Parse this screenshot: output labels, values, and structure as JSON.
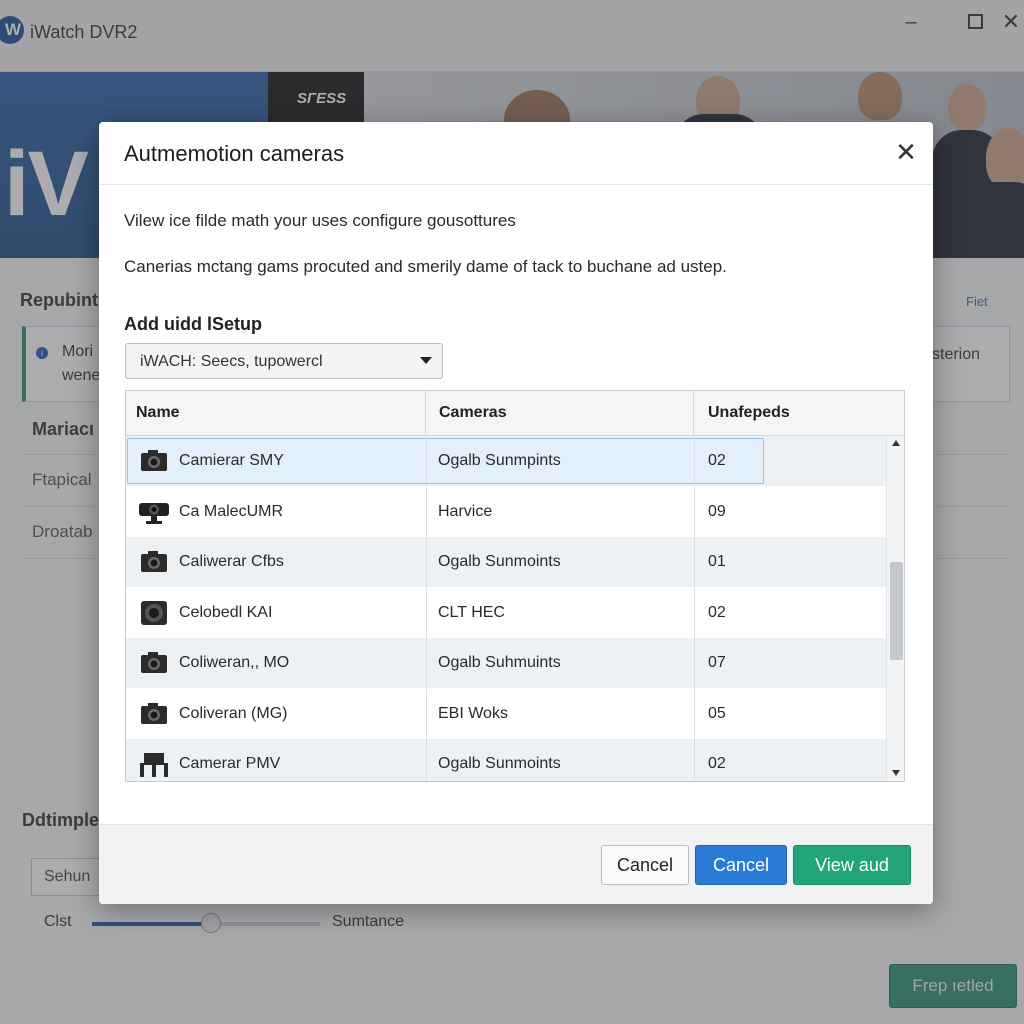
{
  "window": {
    "title": "iWatch DVR2",
    "logo_letter": "W",
    "minimize": "×",
    "close": "✕"
  },
  "banner": {
    "logo_text": "iV",
    "dark_label": "SΓESS"
  },
  "background": {
    "section1_title": "Repubint",
    "info_line1": "Mori",
    "info_line2": "wene",
    "right_link": "Fiet",
    "right_text": "sterion",
    "section2_title": "Mariacı",
    "item1": "Ftapical",
    "item2": "Droatab",
    "section3_title": "Ddtimple",
    "input_value": "Sehun",
    "slider_left_label": "Clst",
    "slider_right_label": "Sumtance",
    "slider_level": 0.52,
    "button_label": "Frep ıetled"
  },
  "dialog": {
    "title": "Autmemotion cameras",
    "close_glyph": "✕",
    "description1": "Vilew ice filde math your uses configure gousottures",
    "description2": "Canerias mctang gams procuted and smerily dame of tack to buchane ad ustep.",
    "select_label": "Add uidd lSetup",
    "select_value": "iWACH: Seecs, tupowercl",
    "table": {
      "columns": [
        "Name",
        "Cameras",
        "Unafepeds"
      ],
      "rows": [
        {
          "icon": "camera-icon",
          "name": "Camierar SMY",
          "cameras": "Ogalb Sunmpints",
          "count": "02"
        },
        {
          "icon": "webcam-icon",
          "name": "Ca MalecUMR",
          "cameras": "Harvice",
          "count": "09"
        },
        {
          "icon": "camera-icon",
          "name": "Caliwerar Cfbs",
          "cameras": "Ogalb Sunmoints",
          "count": "01"
        },
        {
          "icon": "lens-icon",
          "name": "Celobedl KAI",
          "cameras": "CLT HEC",
          "count": "02"
        },
        {
          "icon": "camera-icon",
          "name": "Coliweran,, MO",
          "cameras": "Ogalb Suhmuints",
          "count": "07"
        },
        {
          "icon": "camera-icon",
          "name": "Coliveran (MG)",
          "cameras": "EBI Woks",
          "count": "05"
        },
        {
          "icon": "tripod-icon",
          "name": "Camerar PMV",
          "cameras": "Ogalb Sunmoints",
          "count": "02"
        }
      ]
    },
    "buttons": {
      "cancel1": "Cancel",
      "cancel2": "Cancel",
      "view": "View aud"
    }
  },
  "colors": {
    "primary": "#2a7bd6",
    "success": "#23a57c",
    "brand": "#1f4d8a"
  }
}
